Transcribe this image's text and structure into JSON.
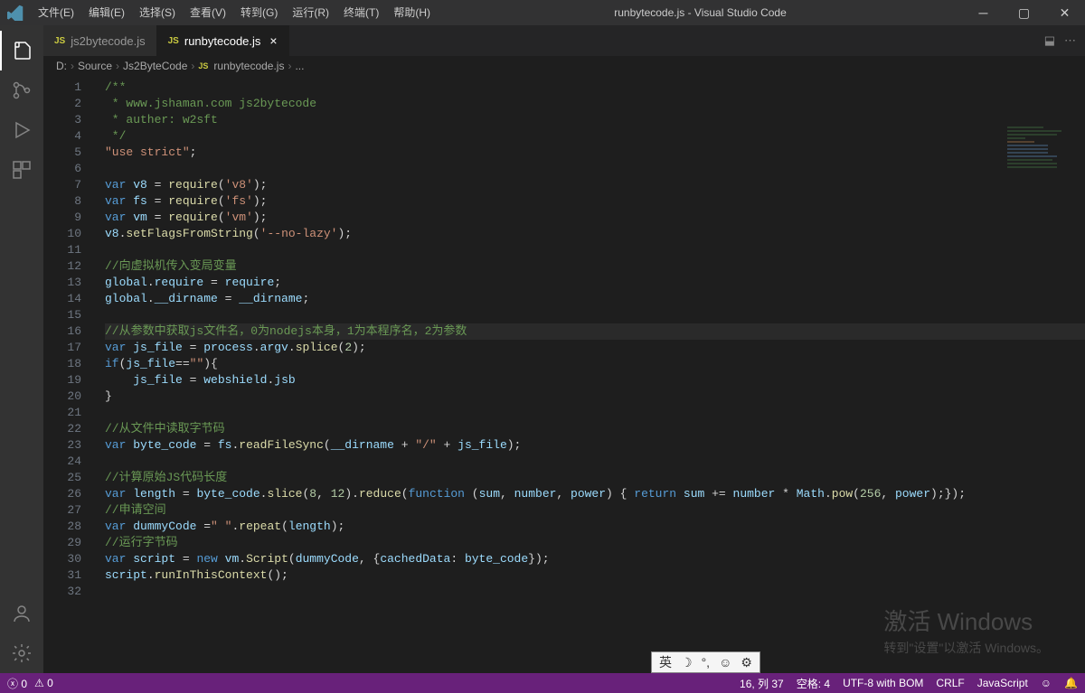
{
  "titlebar": {
    "menus": [
      "文件(E)",
      "编辑(E)",
      "选择(S)",
      "查看(V)",
      "转到(G)",
      "运行(R)",
      "终端(T)",
      "帮助(H)"
    ],
    "title": "runbytecode.js - Visual Studio Code"
  },
  "tabs": [
    {
      "icon": "JS",
      "label": "js2bytecode.js",
      "active": false,
      "dirty": false
    },
    {
      "icon": "JS",
      "label": "runbytecode.js",
      "active": true,
      "dirty": false
    }
  ],
  "breadcrumbs": {
    "items": [
      "D:",
      "Source",
      "Js2ByteCode"
    ],
    "file": "runbytecode.js",
    "tail": "..."
  },
  "code_lines": [
    [
      [
        "c-com",
        "/**"
      ]
    ],
    [
      [
        "c-com",
        " * www.jshaman.com js2bytecode"
      ]
    ],
    [
      [
        "c-com",
        " * auther: w2sft"
      ]
    ],
    [
      [
        "c-com",
        " */"
      ]
    ],
    [
      [
        "c-str",
        "\"use strict\""
      ],
      [
        "c-def",
        ";"
      ]
    ],
    [],
    [
      [
        "c-key",
        "var"
      ],
      [
        "c-def",
        " "
      ],
      [
        "c-var",
        "v8"
      ],
      [
        "c-def",
        " = "
      ],
      [
        "c-fn",
        "require"
      ],
      [
        "c-def",
        "("
      ],
      [
        "c-str",
        "'v8'"
      ],
      [
        "c-def",
        ");"
      ]
    ],
    [
      [
        "c-key",
        "var"
      ],
      [
        "c-def",
        " "
      ],
      [
        "c-var",
        "fs"
      ],
      [
        "c-def",
        " = "
      ],
      [
        "c-fn",
        "require"
      ],
      [
        "c-def",
        "("
      ],
      [
        "c-str",
        "'fs'"
      ],
      [
        "c-def",
        ");"
      ]
    ],
    [
      [
        "c-key",
        "var"
      ],
      [
        "c-def",
        " "
      ],
      [
        "c-var",
        "vm"
      ],
      [
        "c-def",
        " = "
      ],
      [
        "c-fn",
        "require"
      ],
      [
        "c-def",
        "("
      ],
      [
        "c-str",
        "'vm'"
      ],
      [
        "c-def",
        ");"
      ]
    ],
    [
      [
        "c-var",
        "v8"
      ],
      [
        "c-def",
        "."
      ],
      [
        "c-fn",
        "setFlagsFromString"
      ],
      [
        "c-def",
        "("
      ],
      [
        "c-str",
        "'--no-lazy'"
      ],
      [
        "c-def",
        ");"
      ]
    ],
    [],
    [
      [
        "c-com",
        "//向虚拟机传入变局变量"
      ]
    ],
    [
      [
        "c-var",
        "global"
      ],
      [
        "c-def",
        "."
      ],
      [
        "c-var",
        "require"
      ],
      [
        "c-def",
        " = "
      ],
      [
        "c-var",
        "require"
      ],
      [
        "c-def",
        ";"
      ]
    ],
    [
      [
        "c-var",
        "global"
      ],
      [
        "c-def",
        "."
      ],
      [
        "c-var",
        "__dirname"
      ],
      [
        "c-def",
        " = "
      ],
      [
        "c-var",
        "__dirname"
      ],
      [
        "c-def",
        ";"
      ]
    ],
    [],
    [
      [
        "c-com",
        "//从参数中获取js文件名，0为nodejs本身，1为本程序名，2为参数"
      ]
    ],
    [
      [
        "c-key",
        "var"
      ],
      [
        "c-def",
        " "
      ],
      [
        "c-var",
        "js_file"
      ],
      [
        "c-def",
        " = "
      ],
      [
        "c-var",
        "process"
      ],
      [
        "c-def",
        "."
      ],
      [
        "c-var",
        "argv"
      ],
      [
        "c-def",
        "."
      ],
      [
        "c-fn",
        "splice"
      ],
      [
        "c-def",
        "("
      ],
      [
        "c-num",
        "2"
      ],
      [
        "c-def",
        ");"
      ]
    ],
    [
      [
        "c-key",
        "if"
      ],
      [
        "c-def",
        "("
      ],
      [
        "c-var",
        "js_file"
      ],
      [
        "c-def",
        "=="
      ],
      [
        "c-str",
        "\"\""
      ],
      [
        "c-def",
        "){"
      ]
    ],
    [
      [
        "c-def",
        "    "
      ],
      [
        "c-var",
        "js_file"
      ],
      [
        "c-def",
        " = "
      ],
      [
        "c-var",
        "webshield"
      ],
      [
        "c-def",
        "."
      ],
      [
        "c-var",
        "jsb"
      ]
    ],
    [
      [
        "c-def",
        "}"
      ]
    ],
    [],
    [
      [
        "c-com",
        "//从文件中读取字节码"
      ]
    ],
    [
      [
        "c-key",
        "var"
      ],
      [
        "c-def",
        " "
      ],
      [
        "c-var",
        "byte_code"
      ],
      [
        "c-def",
        " = "
      ],
      [
        "c-var",
        "fs"
      ],
      [
        "c-def",
        "."
      ],
      [
        "c-fn",
        "readFileSync"
      ],
      [
        "c-def",
        "("
      ],
      [
        "c-var",
        "__dirname"
      ],
      [
        "c-def",
        " + "
      ],
      [
        "c-str",
        "\"/\""
      ],
      [
        "c-def",
        " + "
      ],
      [
        "c-var",
        "js_file"
      ],
      [
        "c-def",
        ");"
      ]
    ],
    [],
    [
      [
        "c-com",
        "//计算原始JS代码长度"
      ]
    ],
    [
      [
        "c-key",
        "var"
      ],
      [
        "c-def",
        " "
      ],
      [
        "c-var",
        "length"
      ],
      [
        "c-def",
        " = "
      ],
      [
        "c-var",
        "byte_code"
      ],
      [
        "c-def",
        "."
      ],
      [
        "c-fn",
        "slice"
      ],
      [
        "c-def",
        "("
      ],
      [
        "c-num",
        "8"
      ],
      [
        "c-def",
        ", "
      ],
      [
        "c-num",
        "12"
      ],
      [
        "c-def",
        ")."
      ],
      [
        "c-fn",
        "reduce"
      ],
      [
        "c-def",
        "("
      ],
      [
        "c-key",
        "function"
      ],
      [
        "c-def",
        " ("
      ],
      [
        "c-var",
        "sum"
      ],
      [
        "c-def",
        ", "
      ],
      [
        "c-var",
        "number"
      ],
      [
        "c-def",
        ", "
      ],
      [
        "c-var",
        "power"
      ],
      [
        "c-def",
        ") { "
      ],
      [
        "c-key",
        "return"
      ],
      [
        "c-def",
        " "
      ],
      [
        "c-var",
        "sum"
      ],
      [
        "c-def",
        " += "
      ],
      [
        "c-var",
        "number"
      ],
      [
        "c-def",
        " * "
      ],
      [
        "c-var",
        "Math"
      ],
      [
        "c-def",
        "."
      ],
      [
        "c-fn",
        "pow"
      ],
      [
        "c-def",
        "("
      ],
      [
        "c-num",
        "256"
      ],
      [
        "c-def",
        ", "
      ],
      [
        "c-var",
        "power"
      ],
      [
        "c-def",
        ");});"
      ]
    ],
    [
      [
        "c-com",
        "//申请空间"
      ]
    ],
    [
      [
        "c-key",
        "var"
      ],
      [
        "c-def",
        " "
      ],
      [
        "c-var",
        "dummyCode"
      ],
      [
        "c-def",
        " ="
      ],
      [
        "c-str",
        "\" \""
      ],
      [
        "c-def",
        "."
      ],
      [
        "c-fn",
        "repeat"
      ],
      [
        "c-def",
        "("
      ],
      [
        "c-var",
        "length"
      ],
      [
        "c-def",
        ");"
      ]
    ],
    [
      [
        "c-com",
        "//运行字节码"
      ]
    ],
    [
      [
        "c-key",
        "var"
      ],
      [
        "c-def",
        " "
      ],
      [
        "c-var",
        "script"
      ],
      [
        "c-def",
        " = "
      ],
      [
        "c-key",
        "new"
      ],
      [
        "c-def",
        " "
      ],
      [
        "c-var",
        "vm"
      ],
      [
        "c-def",
        "."
      ],
      [
        "c-fn",
        "Script"
      ],
      [
        "c-def",
        "("
      ],
      [
        "c-var",
        "dummyCode"
      ],
      [
        "c-def",
        ", {"
      ],
      [
        "c-var",
        "cachedData"
      ],
      [
        "c-def",
        ": "
      ],
      [
        "c-var",
        "byte_code"
      ],
      [
        "c-def",
        "});"
      ]
    ],
    [
      [
        "c-var",
        "script"
      ],
      [
        "c-def",
        "."
      ],
      [
        "c-fn",
        "runInThisContext"
      ],
      [
        "c-def",
        "();"
      ]
    ],
    []
  ],
  "highlight_line": 16,
  "statusbar": {
    "errors": "0",
    "warnings": "0",
    "cursor": "16, 列 37",
    "spaces": "空格: 4",
    "encoding": "UTF-8 with BOM",
    "eol": "CRLF",
    "lang": "JavaScript"
  },
  "ime": {
    "lang": "英"
  },
  "watermark": {
    "l1": "激活 Windows",
    "l2": "转到\"设置\"以激活 Windows。"
  }
}
